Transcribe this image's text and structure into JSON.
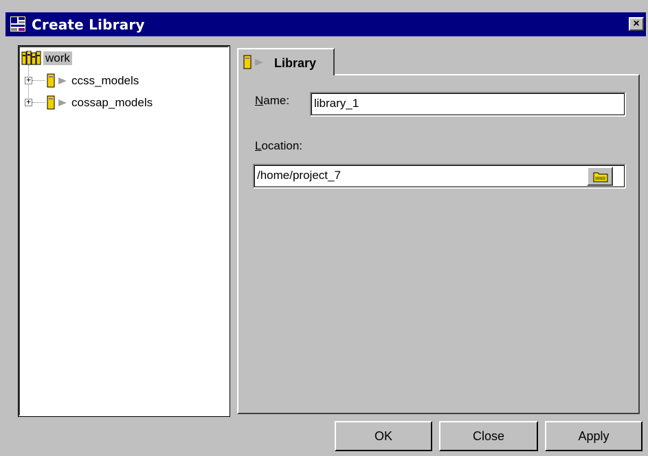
{
  "window": {
    "title": "Create Library",
    "close_label": "×"
  },
  "tree": {
    "items": [
      {
        "label": "work",
        "selected": true,
        "expandable": false
      },
      {
        "label": "ccss_models",
        "selected": false,
        "expandable": true,
        "expander": "+"
      },
      {
        "label": "cossap_models",
        "selected": false,
        "expandable": true,
        "expander": "+"
      }
    ]
  },
  "tab": {
    "label": "Library"
  },
  "form": {
    "name_label_u": "N",
    "name_label_rest": "ame:",
    "name_value": "library_1",
    "location_label_u": "L",
    "location_label_rest": "ocation:",
    "location_value": "/home/project_7"
  },
  "buttons": {
    "ok": "OK",
    "close": "Close",
    "apply": "Apply"
  },
  "colors": {
    "titlebar": "#000080",
    "face": "#c0c0c0",
    "book_yellow": "#f0d000"
  },
  "icons": {
    "title": "library-app-icon",
    "library_root": "books-icon",
    "library": "book-icon",
    "browse": "folder-icon"
  }
}
